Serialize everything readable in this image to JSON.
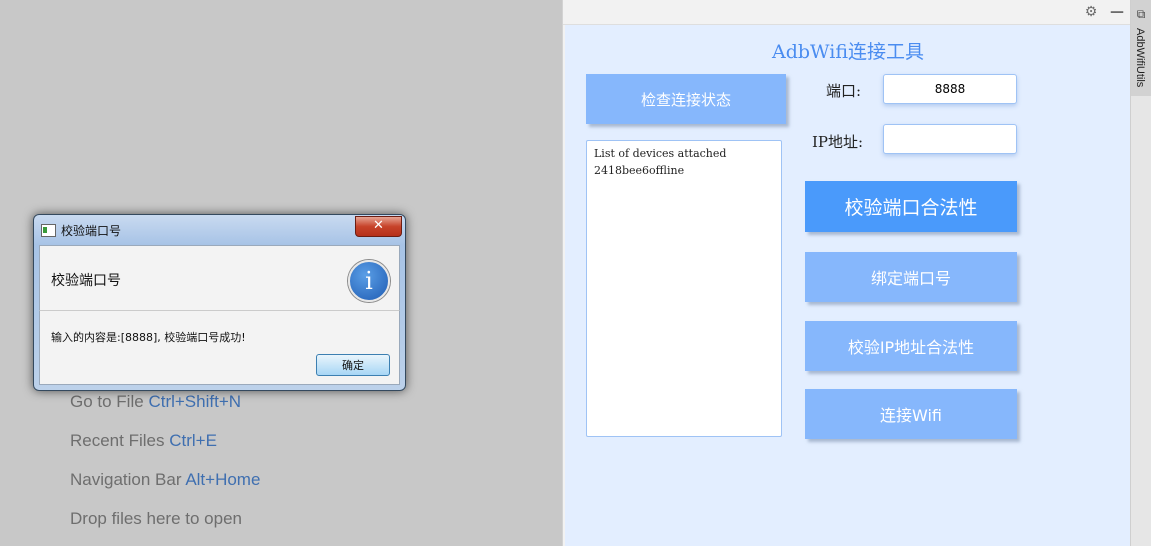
{
  "editor_hints": [
    {
      "text": "Go to File",
      "shortcut": "Ctrl+Shift+N"
    },
    {
      "text": "Recent Files",
      "shortcut": "Ctrl+E"
    },
    {
      "text": "Navigation Bar",
      "shortcut": "Alt+Home"
    },
    {
      "text": "Drop files here to open",
      "shortcut": ""
    }
  ],
  "tool_window": {
    "header_icons": [
      "gear-icon",
      "minimize-icon"
    ],
    "side_tab_label": "AdbWifiUtils",
    "side_tab_icon": "tool-window-icon"
  },
  "app": {
    "title": "AdbWifi连接工具",
    "check_status_button": "检查连接状态",
    "port_label": "端口:",
    "port_value": "8888",
    "ip_label": "IP地址:",
    "ip_value": "",
    "devices_output": [
      "List of devices attached",
      "2418bee6offline"
    ],
    "validate_port_button": "校验端口合法性",
    "bind_port_button": "绑定端口号",
    "validate_ip_button": "校验IP地址合法性",
    "connect_wifi_button": "连接Wifi"
  },
  "dialog": {
    "title": "校验端口号",
    "close_label": "✕",
    "header": "校验端口号",
    "info_icon": "i",
    "message": "输入的内容是:[8888], 校验端口号成功!",
    "ok_label": "确定"
  },
  "colors": {
    "accent": "#4a9afb",
    "button_light": "#86b7fc",
    "panel_bg": "#e3eeff",
    "title_color": "#4a8cf0"
  }
}
